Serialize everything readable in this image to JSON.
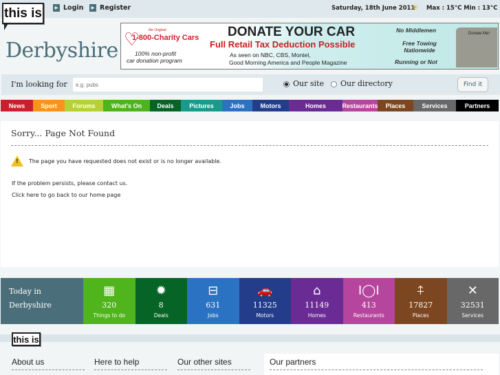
{
  "header": {
    "logo": "this is",
    "login": "Login",
    "register": "Register",
    "date": "Saturday, 18th June 2011",
    "weather_icon": "sun-cloud-icon",
    "weather": "Max : 15°C  Min : 13°C",
    "site_name": "Derbyshire"
  },
  "ad": {
    "brand_small": "the Original",
    "brand": "1-800-Charity Cars",
    "tag1": "100% non-profit",
    "tag2": "car donation program",
    "headline": "DONATE YOUR CAR",
    "sub": "Full Retail Tax Deduction Possible",
    "seen1": "As seen on NBC, CBS, Montel,",
    "seen2": "Good Morning America and People Magazine",
    "r1": "No Middlemen",
    "r2": "Free Towing Nationwide",
    "r3": "Running or Not",
    "car_text": "Donate Me!"
  },
  "search": {
    "label": "I'm looking for",
    "placeholder": "e.g. pubs",
    "opt1": "Our site",
    "opt2": "Our directory",
    "selected": "Our site",
    "button": "Find it"
  },
  "nav": [
    {
      "label": "News",
      "color": "#c8202c"
    },
    {
      "label": "Sport",
      "color": "#f7941d"
    },
    {
      "label": "Forums",
      "color": "#b6d037"
    },
    {
      "label": "What's On",
      "color": "#4cb41d"
    },
    {
      "label": "Deals",
      "color": "#066426"
    },
    {
      "label": "Pictures",
      "color": "#1b9a8b"
    },
    {
      "label": "Jobs",
      "color": "#2b73c2"
    },
    {
      "label": "Motors",
      "color": "#233d8b"
    },
    {
      "label": "Homes",
      "color": "#6a2b94"
    },
    {
      "label": "Restaurants",
      "color": "#b6459d"
    },
    {
      "label": "Places",
      "color": "#7c4720"
    },
    {
      "label": "Services",
      "color": "#686868"
    },
    {
      "label": "Partners",
      "color": "#000000"
    }
  ],
  "main": {
    "title": "Sorry... Page Not Found",
    "warning_icon": "warning-icon",
    "message": "The page you have requested does not exist or is no longer available.",
    "line1": "If the problem persists, please contact us.",
    "line2": "Click here to go back to our home page"
  },
  "today": {
    "title1": "Today in",
    "title2": "Derbyshire",
    "tiles": [
      {
        "icon": "calendar-icon",
        "glyph": "▦",
        "count": "320",
        "label": "Things to do",
        "color": "#50b41c"
      },
      {
        "icon": "deals-pound-icon",
        "glyph": "✹",
        "count": "8",
        "label": "Deals",
        "color": "#066426"
      },
      {
        "icon": "briefcase-icon",
        "glyph": "⊟",
        "count": "631",
        "label": "Jobs",
        "color": "#2b73c2"
      },
      {
        "icon": "car-icon",
        "glyph": "🚗",
        "count": "11325",
        "label": "Motors",
        "color": "#233d8b"
      },
      {
        "icon": "house-icon",
        "glyph": "⌂",
        "count": "11149",
        "label": "Homes",
        "color": "#6a2b94"
      },
      {
        "icon": "plate-cutlery-icon",
        "glyph": "Ⅰ◯Ⅰ",
        "count": "413",
        "label": "Restaurants",
        "color": "#b6459d"
      },
      {
        "icon": "signpost-icon",
        "glyph": "⍏",
        "count": "17827",
        "label": "Places",
        "color": "#7c4720"
      },
      {
        "icon": "tools-icon",
        "glyph": "✕",
        "count": "32531",
        "label": "Services",
        "color": "#686868"
      }
    ]
  },
  "footer": {
    "logo": "this is",
    "cols": [
      "About us",
      "Here to help",
      "Our other sites",
      "Our partners"
    ]
  }
}
